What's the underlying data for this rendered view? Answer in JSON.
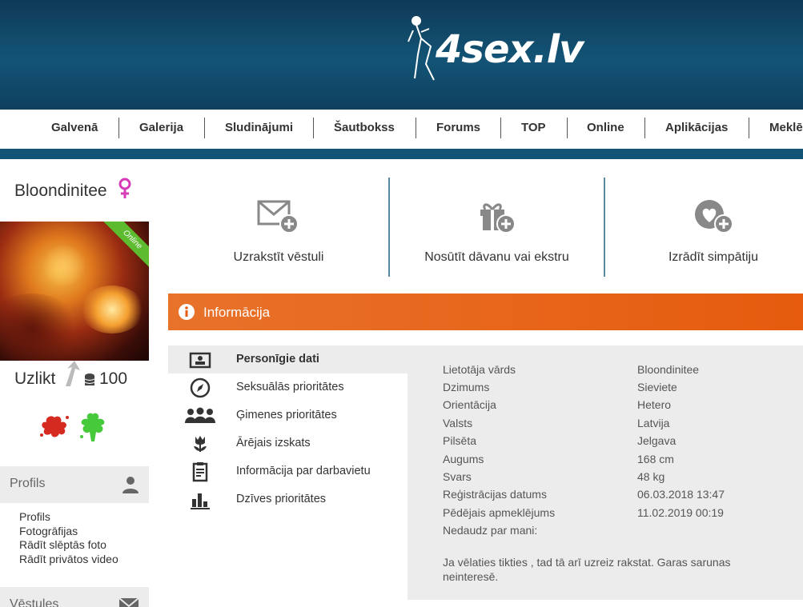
{
  "site": {
    "logo_text": "4sex.lv"
  },
  "nav": {
    "items": [
      "Galvenā",
      "Galerija",
      "Sludinājumi",
      "Šautbokss",
      "Forums",
      "TOP",
      "Online",
      "Aplikācijas",
      "Meklē"
    ]
  },
  "profile": {
    "username": "Bloondinitee",
    "online_badge": "Online",
    "uzlikt_label": "Uzlikt",
    "coins": "100"
  },
  "sidebar": {
    "profile_section": "Profils",
    "links": [
      "Profils",
      "Fotogrāfijas",
      "Rādīt slēptās foto",
      "Rādīt privātos video"
    ],
    "messages_section": "Vēstules"
  },
  "actions": {
    "write_letter": "Uzrakstīt vēstuli",
    "send_gift": "Nosūtīt dāvanu vai ekstru",
    "show_sympathy": "Izrādīt simpātiju"
  },
  "info": {
    "title": "Informācija",
    "menu": [
      {
        "label": "Personīgie dati",
        "icon": "id-card-icon"
      },
      {
        "label": "Seksuālās prioritātes",
        "icon": "compass-icon"
      },
      {
        "label": "Ģimenes prioritātes",
        "icon": "family-icon"
      },
      {
        "label": "Ārējais izskats",
        "icon": "flower-icon"
      },
      {
        "label": "Informācija par darbavietu",
        "icon": "clipboard-icon"
      },
      {
        "label": "Dzīves prioritātes",
        "icon": "bar-chart-icon"
      }
    ],
    "rows": [
      {
        "label": "Lietotāja vārds",
        "value": "Bloondinitee"
      },
      {
        "label": "Dzimums",
        "value": "Sieviete"
      },
      {
        "label": "Orientācija",
        "value": "Hetero"
      },
      {
        "label": "Valsts",
        "value": "Latvija"
      },
      {
        "label": "Pilsēta",
        "value": "Jelgava"
      },
      {
        "label": "Augums",
        "value": "168 cm"
      },
      {
        "label": "Svars",
        "value": "48 kg"
      },
      {
        "label": "Reģistrācijas datums",
        "value": "06.03.2018 13:47"
      },
      {
        "label": "Pēdējais apmeklējums",
        "value": "11.02.2019 00:19"
      }
    ],
    "about_label": "Nedaudz par mani:",
    "about_text": "Ja vēlaties tikties , tad tā arī uzreiz rakstat. Garas sarunas neinteresē."
  },
  "colors": {
    "header_blue": "#135476",
    "accent_orange": "#e65b0e",
    "online_green": "#5dbb2f",
    "female_pink": "#d63bb8"
  }
}
